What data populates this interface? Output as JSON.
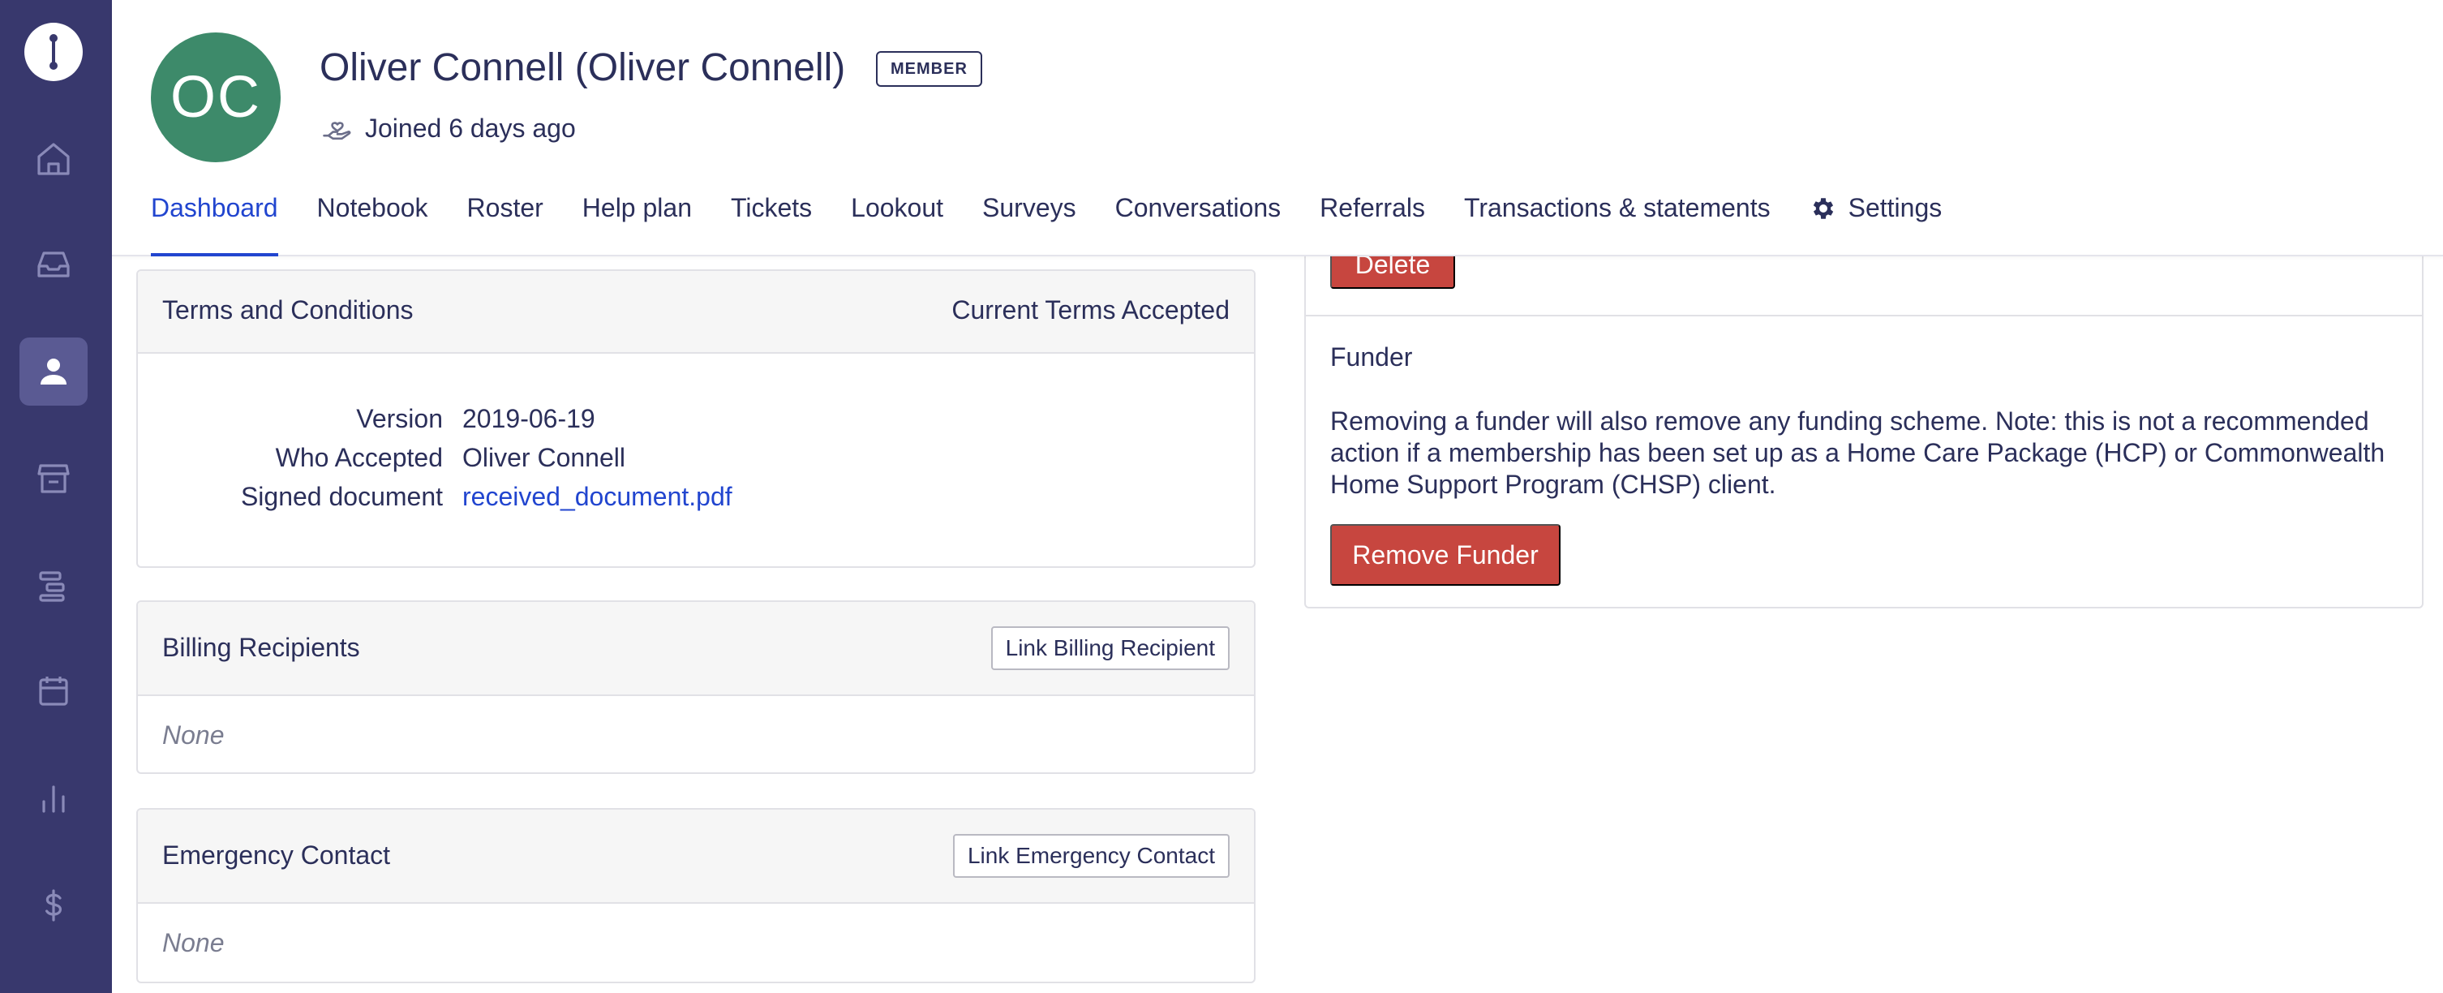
{
  "sidebar": {
    "items": [
      {
        "icon": "home-icon"
      },
      {
        "icon": "inbox-icon"
      },
      {
        "icon": "person-icon",
        "active": true
      },
      {
        "icon": "store-icon"
      },
      {
        "icon": "timeline-icon"
      },
      {
        "icon": "calendar-icon"
      },
      {
        "icon": "bar-chart-icon"
      },
      {
        "icon": "dollar-icon"
      }
    ]
  },
  "header": {
    "avatar_initials": "OC",
    "name": "Oliver Connell (Oliver Connell)",
    "badge": "MEMBER",
    "joined": "Joined 6 days ago"
  },
  "tabs": [
    {
      "label": "Dashboard",
      "active": true
    },
    {
      "label": "Notebook"
    },
    {
      "label": "Roster"
    },
    {
      "label": "Help plan"
    },
    {
      "label": "Tickets"
    },
    {
      "label": "Lookout"
    },
    {
      "label": "Surveys"
    },
    {
      "label": "Conversations"
    },
    {
      "label": "Referrals"
    },
    {
      "label": "Transactions & statements"
    },
    {
      "label": "Settings"
    }
  ],
  "terms": {
    "title": "Terms and Conditions",
    "status": "Current Terms Accepted",
    "rows": [
      {
        "key": "Version",
        "value": "2019-06-19"
      },
      {
        "key": "Who Accepted",
        "value": "Oliver Connell"
      },
      {
        "key": "Signed document",
        "value": "received_document.pdf"
      }
    ]
  },
  "billing": {
    "title": "Billing Recipients",
    "button": "Link Billing Recipient",
    "empty": "None"
  },
  "emergency": {
    "title": "Emergency Contact",
    "button": "Link Emergency Contact",
    "empty": "None"
  },
  "right_panel": {
    "delete_button": "Delete",
    "funder_title": "Funder",
    "funder_text": "Removing a funder will also remove any funding scheme. Note: this is not a recommended action if a membership has been set up as a Home Care Package (HCP) or Commonwealth Home Support Program (CHSP) client.",
    "remove_button": "Remove Funder"
  },
  "colors": {
    "sidebar_bg": "#38386d",
    "accent": "#2145cf",
    "avatar_bg": "#3d8a6a",
    "danger": "#c7463f"
  }
}
